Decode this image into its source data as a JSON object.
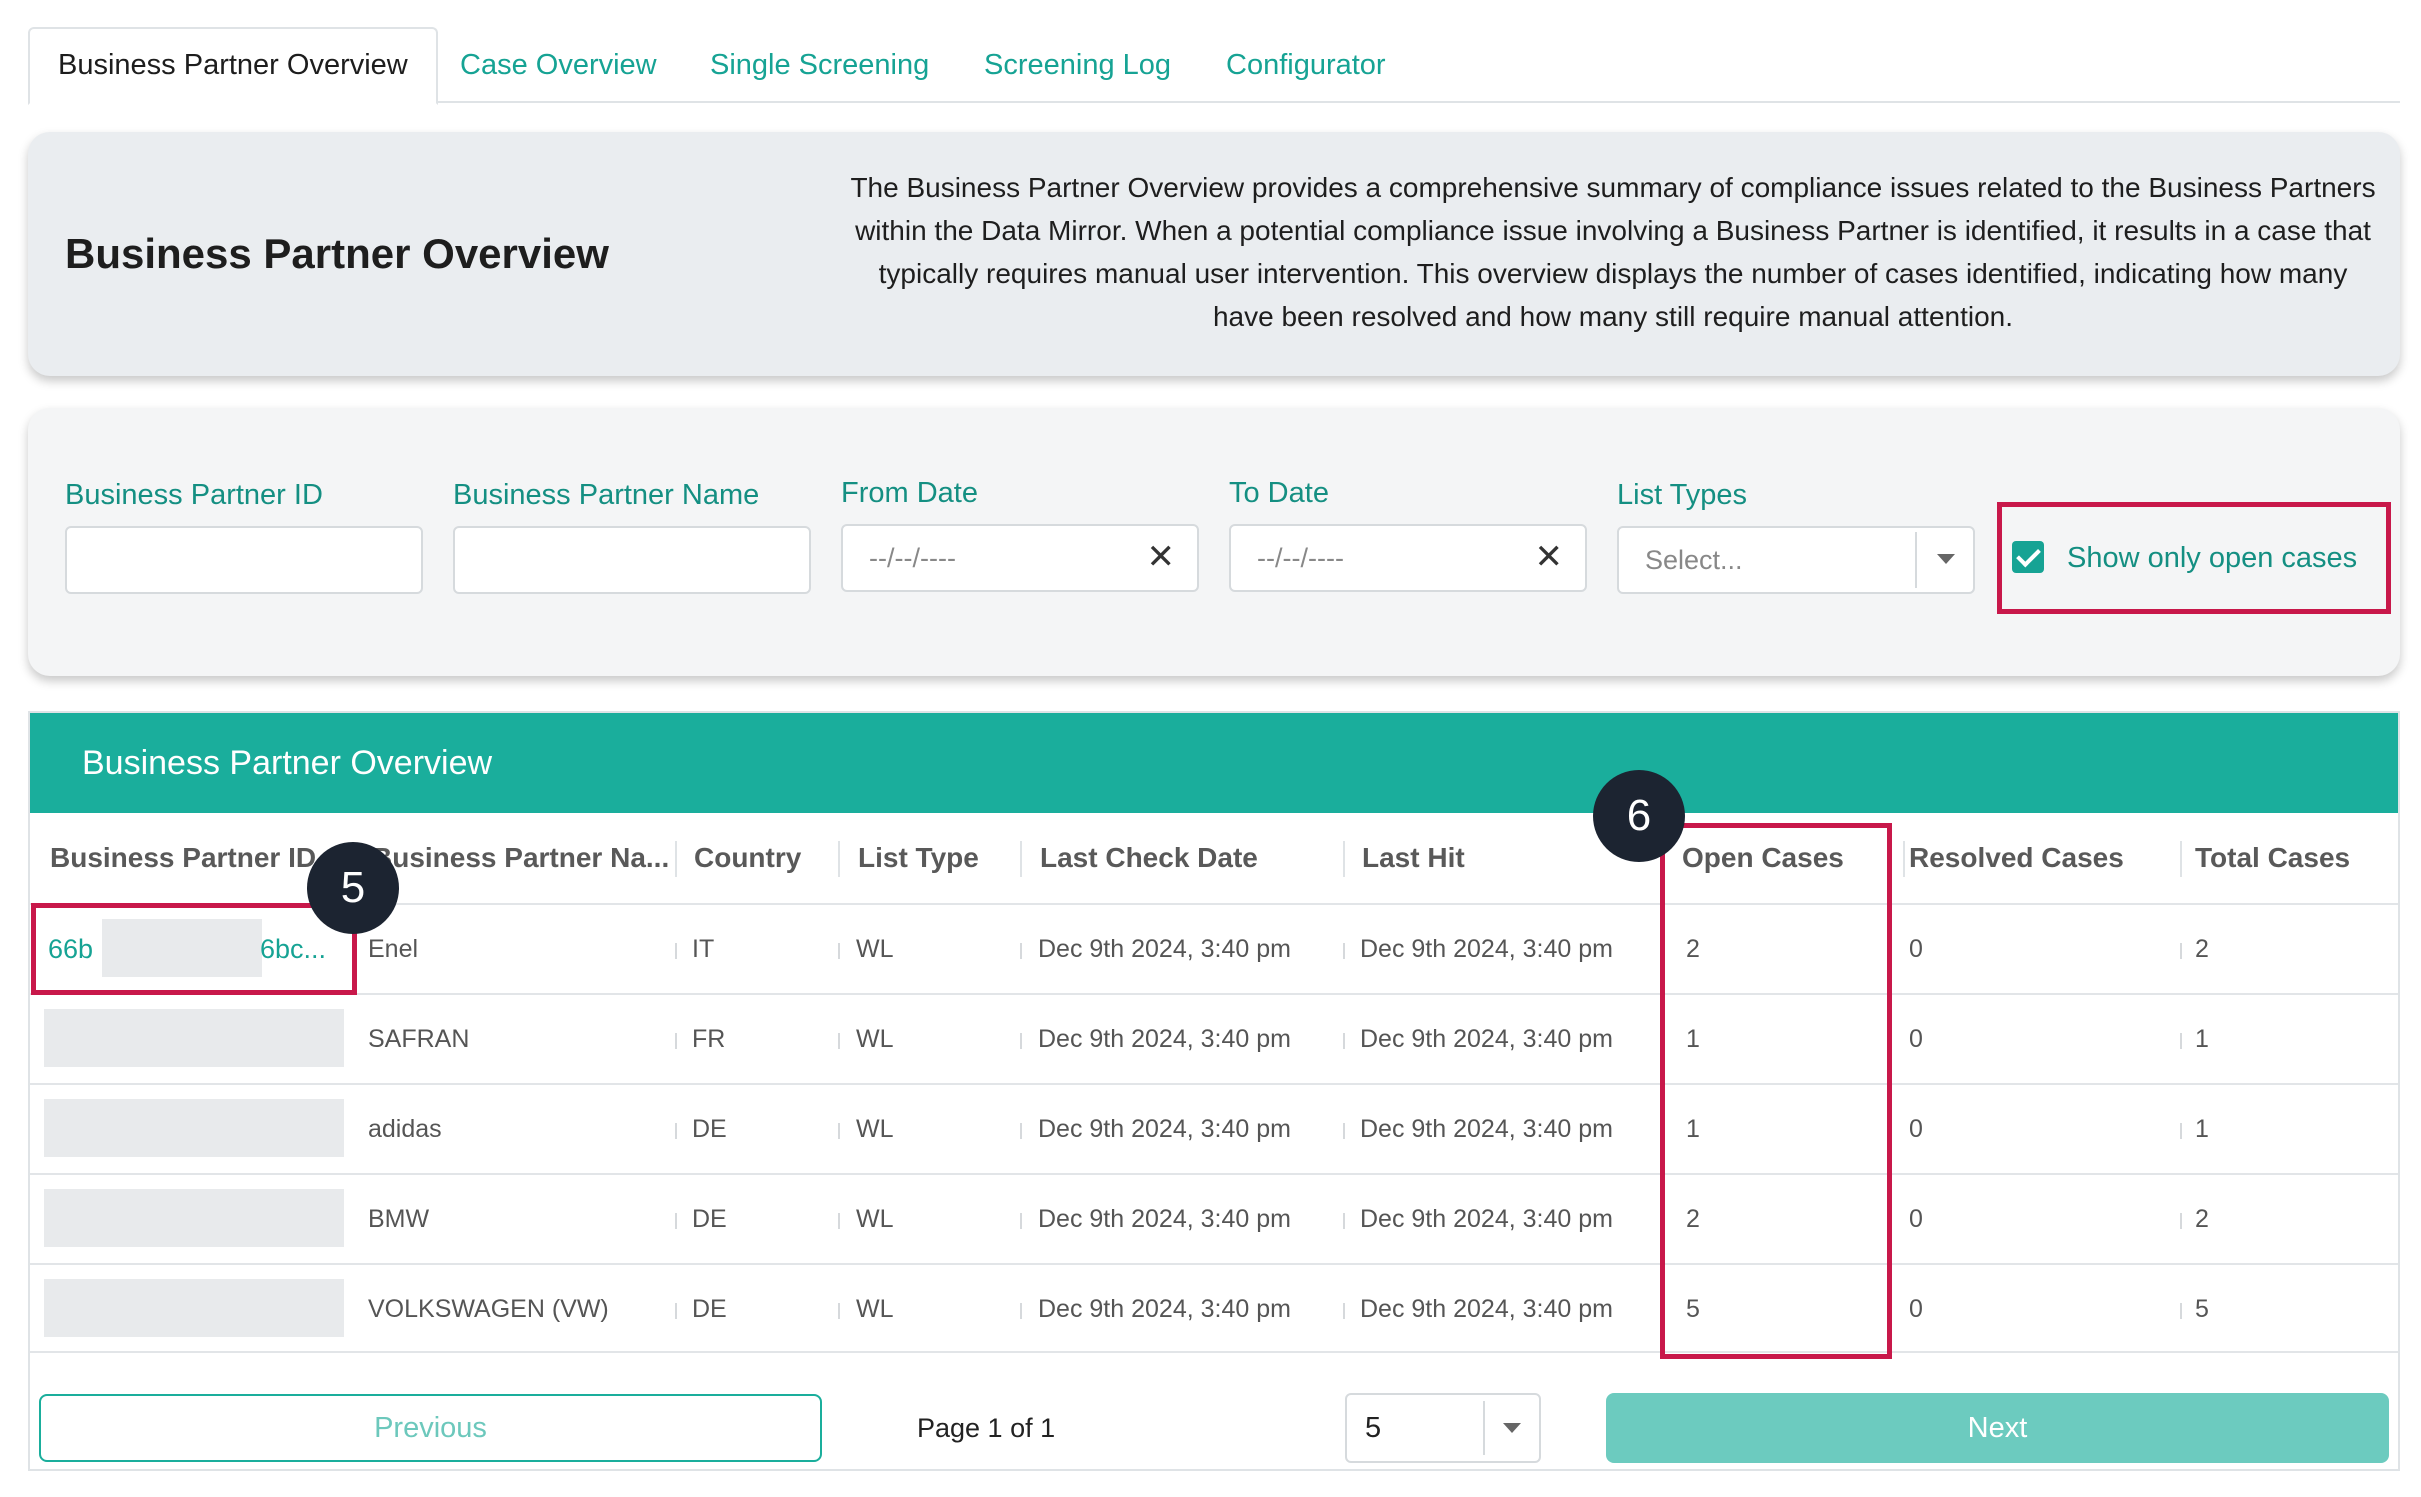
{
  "tabs": [
    {
      "label": "Business Partner Overview",
      "active": true
    },
    {
      "label": "Case Overview"
    },
    {
      "label": "Single Screening"
    },
    {
      "label": "Screening Log"
    },
    {
      "label": "Configurator"
    }
  ],
  "header": {
    "title": "Business Partner Overview",
    "description": "The Business Partner Overview provides a comprehensive summary of compliance issues related to the Business Partners within the Data Mirror. When a potential compliance issue involving a Business Partner is identified, it results in a case that typically requires manual user intervention. This overview displays the number of cases identified, indicating how many have been resolved and how many still require manual attention."
  },
  "filters": {
    "bp_id_label": "Business Partner ID",
    "bp_name_label": "Business Partner Name",
    "from_date_label": "From Date",
    "from_date_placeholder": "--/--/----",
    "to_date_label": "To Date",
    "to_date_placeholder": "--/--/----",
    "list_types_label": "List Types",
    "list_types_placeholder": "Select...",
    "show_open_label": "Show only open cases",
    "show_open_checked": true
  },
  "table": {
    "title": "Business Partner Overview",
    "columns": [
      "Business Partner ID",
      "Business Partner Na...",
      "Country",
      "List Type",
      "Last Check Date",
      "Last Hit",
      "Open Cases",
      "Resolved Cases",
      "Total Cases"
    ],
    "rows": [
      {
        "id_start": "66b",
        "id_end": "6bc...",
        "name": "Enel",
        "country": "IT",
        "list_type": "WL",
        "last_check": "Dec 9th 2024, 3:40 pm",
        "last_hit": "Dec 9th 2024, 3:40 pm",
        "open": "2",
        "resolved": "0",
        "total": "2"
      },
      {
        "name": "SAFRAN",
        "country": "FR",
        "list_type": "WL",
        "last_check": "Dec 9th 2024, 3:40 pm",
        "last_hit": "Dec 9th 2024, 3:40 pm",
        "open": "1",
        "resolved": "0",
        "total": "1"
      },
      {
        "name": "adidas",
        "country": "DE",
        "list_type": "WL",
        "last_check": "Dec 9th 2024, 3:40 pm",
        "last_hit": "Dec 9th 2024, 3:40 pm",
        "open": "1",
        "resolved": "0",
        "total": "1"
      },
      {
        "name": "BMW",
        "country": "DE",
        "list_type": "WL",
        "last_check": "Dec 9th 2024, 3:40 pm",
        "last_hit": "Dec 9th 2024, 3:40 pm",
        "open": "2",
        "resolved": "0",
        "total": "2"
      },
      {
        "name": "VOLKSWAGEN (VW)",
        "country": "DE",
        "list_type": "WL",
        "last_check": "Dec 9th 2024, 3:40 pm",
        "last_hit": "Dec 9th 2024, 3:40 pm",
        "open": "5",
        "resolved": "0",
        "total": "5"
      }
    ]
  },
  "pagination": {
    "previous_label": "Previous",
    "page_info": "Page 1 of 1",
    "page_size": "5",
    "next_label": "Next"
  },
  "annotations": {
    "callout_5": "5",
    "callout_6": "6"
  },
  "colors": {
    "accent": "#1aae9c",
    "highlight": "#c8184a",
    "callout_bg": "#1c2431"
  }
}
